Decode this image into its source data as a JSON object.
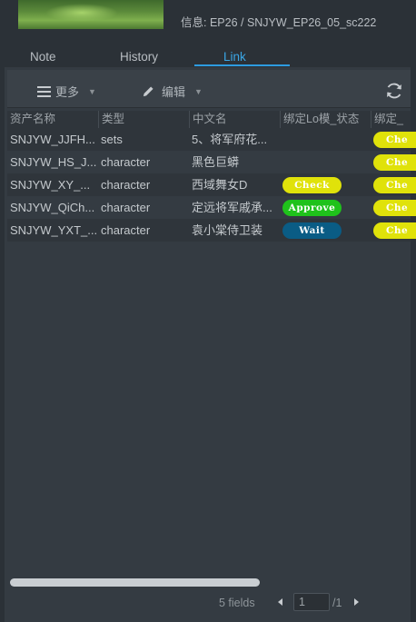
{
  "header": {
    "info": "信息: EP26 / SNJYW_EP26_05_sc222"
  },
  "tabs": [
    {
      "label": "Note",
      "active": false
    },
    {
      "label": "History",
      "active": false
    },
    {
      "label": "Link",
      "active": true
    }
  ],
  "toolbar": {
    "more_label": "更多",
    "more_icon": "menu-icon",
    "edit_label": "编辑",
    "edit_icon": "pencil-icon",
    "refresh_icon": "refresh-icon"
  },
  "table": {
    "columns": [
      "资产名称",
      "类型",
      "中文名",
      "绑定Lo模_状态",
      "绑定_"
    ],
    "rows": [
      {
        "name": "SNJYW_JJFH...",
        "type": "sets",
        "cn": "5、将军府花...",
        "lo_status": "",
        "status2": "Che"
      },
      {
        "name": "SNJYW_HS_J...",
        "type": "character",
        "cn": "黑色巨蟒",
        "lo_status": "",
        "status2": "Che"
      },
      {
        "name": "SNJYW_XY_...",
        "type": "character",
        "cn": "西域舞女D",
        "lo_status": "Check",
        "status2": "Che"
      },
      {
        "name": "SNJYW_QiCh...",
        "type": "character",
        "cn": "定远将军戚承...",
        "lo_status": "Approve",
        "status2": "Che"
      },
      {
        "name": "SNJYW_YXT_...",
        "type": "character",
        "cn": "袁小棠侍卫装",
        "lo_status": "Wait",
        "status2": "Che"
      }
    ]
  },
  "status_colors": {
    "Check": {
      "bg": "#e0e20a",
      "fg": "#ffffff"
    },
    "Approve": {
      "bg": "#1fc21b",
      "fg": "#ffffff"
    },
    "Wait": {
      "bg": "#0a5c85",
      "fg": "#ffffff"
    }
  },
  "pager": {
    "fields_text": "5 fields",
    "page_value": "1",
    "total_text": "/1"
  },
  "accent_color": "#2d9be0"
}
